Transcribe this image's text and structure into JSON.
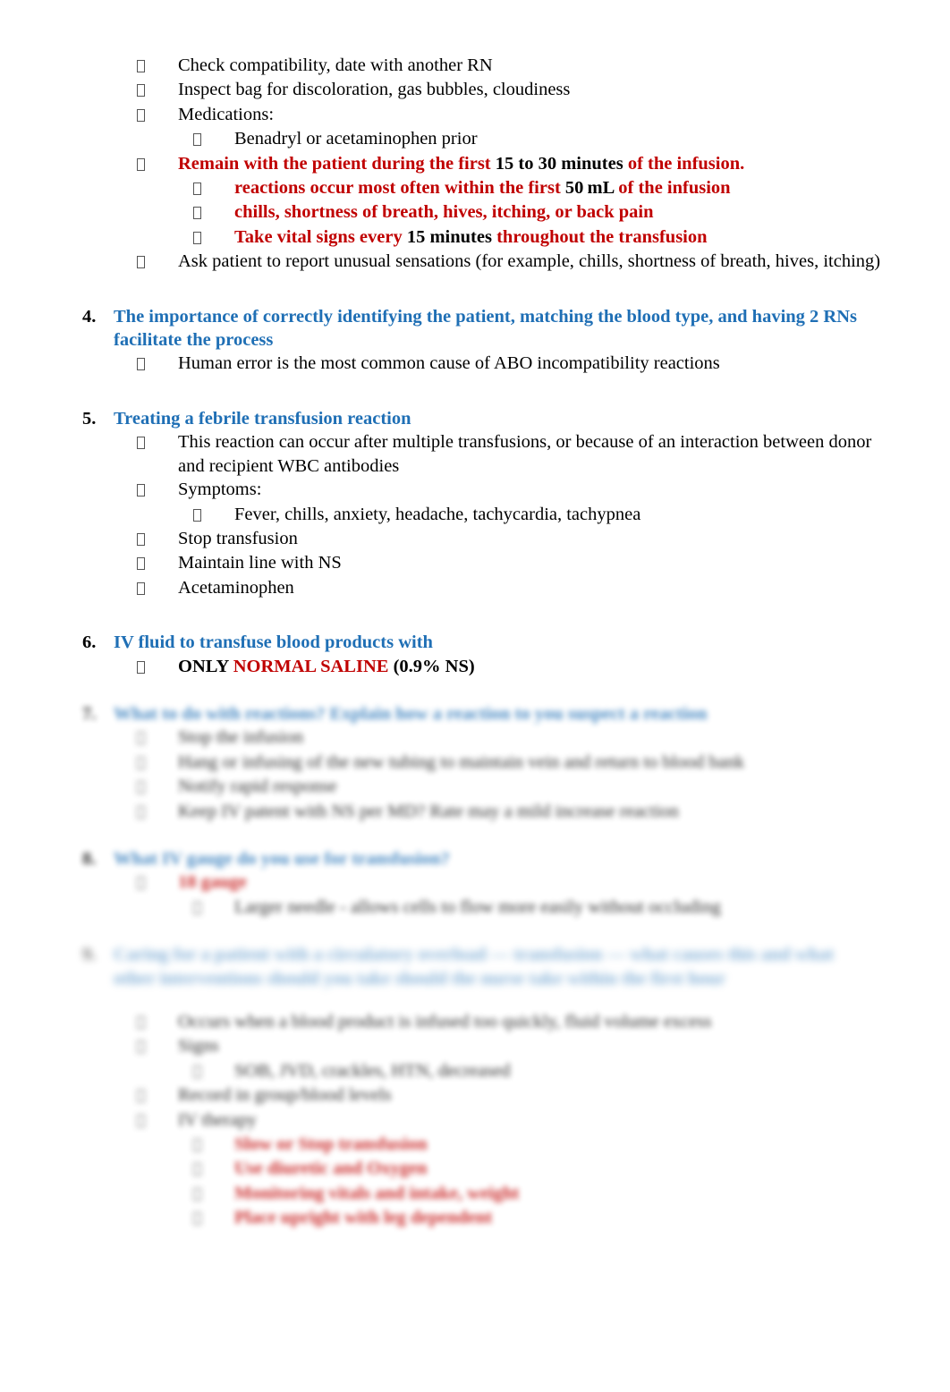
{
  "document": {
    "colors": {
      "heading_blue": "#1F6FB5",
      "emphasis_red": "#C00000",
      "body_black": "#000000",
      "page_background": "#FFFFFF"
    },
    "bullet_glyph": "tofu-box"
  },
  "top_list": {
    "items": [
      {
        "level": 1,
        "text": "Check compatibility, date with another RN"
      },
      {
        "level": 1,
        "text": "Inspect bag for discoloration, gas bubbles, cloudiness"
      },
      {
        "level": 1,
        "text": "Medications:"
      },
      {
        "level": 2,
        "text": "Benadryl or acetaminophen prior"
      }
    ],
    "remain_line": {
      "part_red_1": "Remain with the patient during the first ",
      "part_black_1": "15 to 30 minutes ",
      "part_red_2": "of the infusion."
    },
    "reactions_line": {
      "part_red_1": "reactions occur most often within the first ",
      "part_black_1": "50 mL ",
      "part_red_2": "of the infusion"
    },
    "chills_line": {
      "text_red": "chills, shortness of breath, hives, itching, or back pain"
    },
    "vitals_line": {
      "part_red_1": "Take vital signs every ",
      "part_black_1": "15 minutes ",
      "part_red_2": "throughout the transfusion"
    },
    "ask_line": {
      "text": "Ask patient to report unusual sensations (for example, chills, shortness of breath, hives, itching)"
    }
  },
  "sections": [
    {
      "number": "4.",
      "heading": "The importance of correctly identifying the patient, matching the blood type, and having 2 RNs facilitate the process",
      "items": [
        {
          "level": 1,
          "text": "Human error is the most common cause of ABO incompatibility reactions"
        }
      ]
    },
    {
      "number": "5.",
      "heading": "Treating a febrile transfusion reaction",
      "items": [
        {
          "level": 1,
          "text": "This reaction can occur after multiple transfusions, or because of an interaction between donor and recipient WBC antibodies"
        },
        {
          "level": 1,
          "text": "Symptoms:"
        },
        {
          "level": 2,
          "text": "Fever, chills, anxiety, headache, tachycardia, tachypnea"
        },
        {
          "level": 1,
          "text": "Stop transfusion"
        },
        {
          "level": 1,
          "text": "Maintain line with NS"
        },
        {
          "level": 1,
          "text": "Acetaminophen"
        }
      ]
    },
    {
      "number": "6.",
      "heading": "IV fluid to transfuse blood products with",
      "saline_line": {
        "part_black_1": "ONLY ",
        "part_red_1": "NORMAL SALINE",
        "part_black_2": " (0.9% NS)"
      }
    }
  ],
  "obscured_sections": [
    {
      "number": "7.",
      "heading": "What to do with reactions? Explain how a reaction to you suspect a reaction",
      "legible": false,
      "items": [
        {
          "level": 1,
          "text": "Stop the infusion"
        },
        {
          "level": 1,
          "text": "Hang or infusing of the new tubing to maintain vein and return to blood bank"
        },
        {
          "level": 1,
          "text": "Notify rapid response"
        },
        {
          "level": 1,
          "text": "Keep IV patent with NS per MD? Rate may a mild increase reaction"
        }
      ]
    },
    {
      "number": "8.",
      "heading": "What IV gauge do you use for transfusion?",
      "legible": false,
      "items": [
        {
          "level": 1,
          "text": "18 gauge",
          "color": "red"
        },
        {
          "level": 2,
          "text": "Larger needle - allows cells to flow more easily without occluding"
        }
      ]
    },
    {
      "number": "9.",
      "heading": "Caring for a patient with a circulatory overload — transfusion — what causes this and what other interventions should you take should the nurse take within the first hour",
      "legible": false,
      "items": [
        {
          "level": 1,
          "text": "Occurs when a blood product is infused too quickly, fluid volume excess"
        },
        {
          "level": 1,
          "text": "Signs"
        },
        {
          "level": 2,
          "text": "SOB, JVD, crackles, HTN, decreased"
        },
        {
          "level": 1,
          "text": "Record in group/blood levels"
        },
        {
          "level": 1,
          "text": "IV therapy"
        },
        {
          "level": 2,
          "text": "Slow or Stop transfusion",
          "color": "red"
        },
        {
          "level": 2,
          "text": "Use diuretic and Oxygen",
          "color": "red"
        },
        {
          "level": 2,
          "text": "Monitoring vitals and intake, weight",
          "color": "red"
        },
        {
          "level": 2,
          "text": "Place upright with leg dependent",
          "color": "red"
        }
      ]
    }
  ]
}
